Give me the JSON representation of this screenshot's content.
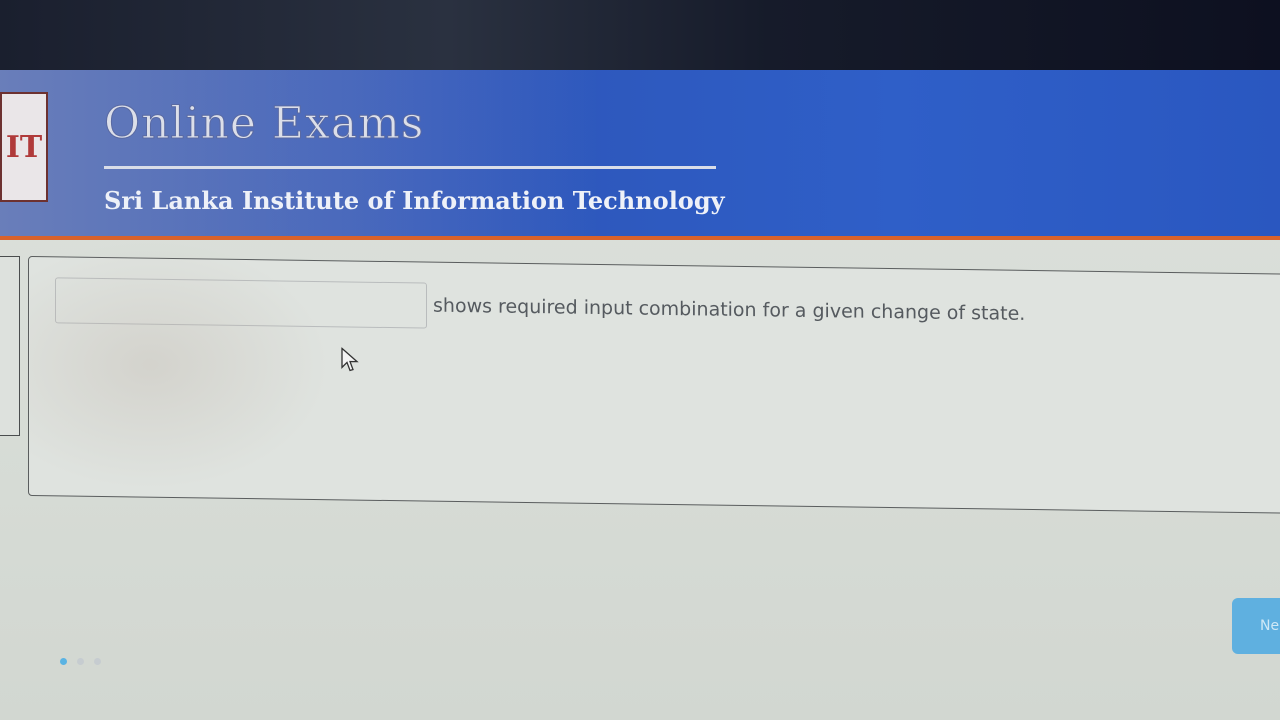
{
  "header": {
    "title": "Online Exams",
    "subtitle": "Sri Lanka Institute of Information Technology",
    "logo_text": "IT"
  },
  "question": {
    "answer_value": "",
    "text": "shows required input combination for a given change of state."
  },
  "footer": {
    "next_label": "Ne"
  },
  "colors": {
    "header_blue": "#2d55b8",
    "accent_orange": "#d9622b",
    "button_blue": "#5fb0e0"
  }
}
